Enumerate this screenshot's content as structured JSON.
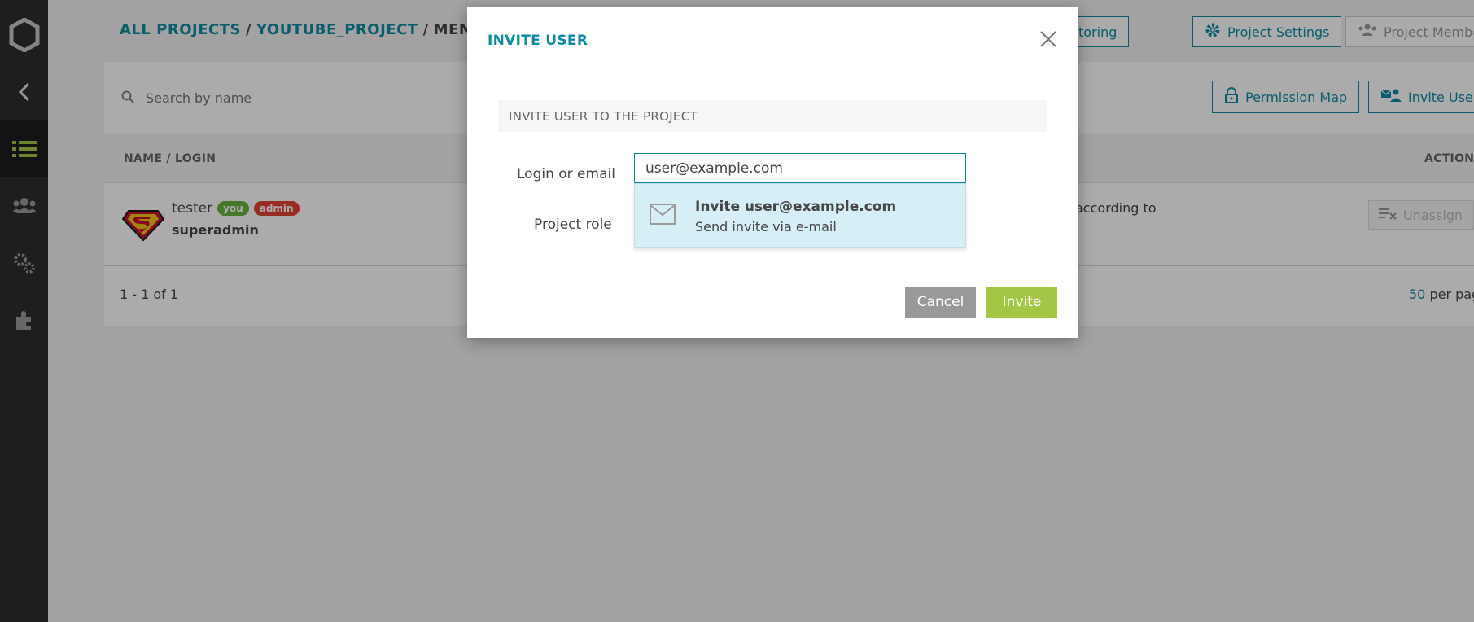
{
  "breadcrumb": {
    "all_projects": "ALL PROJECTS",
    "sep1": "/",
    "project": "YOUTUBE_PROJECT",
    "sep2": "/",
    "current": "MEMBERS"
  },
  "header_buttons": {
    "monitoring": "Project Monitoring",
    "settings": "Project Settings",
    "members": "Project Members"
  },
  "toolbar": {
    "permission_map": "Permission Map",
    "invite_user": "Invite User"
  },
  "search": {
    "placeholder": "Search by name"
  },
  "table": {
    "col_name": "NAME / LOGIN",
    "col_action": "ACTION",
    "rows": [
      {
        "name": "tester",
        "badge_you": "you",
        "badge_admin": "admin",
        "login": "superadmin",
        "role_text": "according to",
        "action": "Unassign"
      }
    ]
  },
  "pager": {
    "range": "1 - 1 of 1",
    "per_page_count": "50",
    "per_page_label": "per page"
  },
  "modal": {
    "title": "INVITE USER",
    "section": "INVITE USER TO THE PROJECT",
    "login_label": "Login or email",
    "login_value": "user@example.com",
    "role_label": "Project role",
    "suggestion_title": "Invite user@example.com",
    "suggestion_sub": "Send invite via e-mail",
    "cancel": "Cancel",
    "invite": "Invite"
  },
  "colors": {
    "accent": "#0e8ba3",
    "invite_green": "#a3c644",
    "badge_you": "#6eb23f",
    "badge_admin": "#e34234",
    "sidebar": "#2e2e2e"
  },
  "icons": {
    "sidebar": [
      "logo-icon",
      "back-arrow-icon",
      "list-icon",
      "members-icon",
      "settings-icon",
      "plugin-icon"
    ],
    "search": "search-icon",
    "close": "close-icon",
    "mail": "mail-icon"
  }
}
